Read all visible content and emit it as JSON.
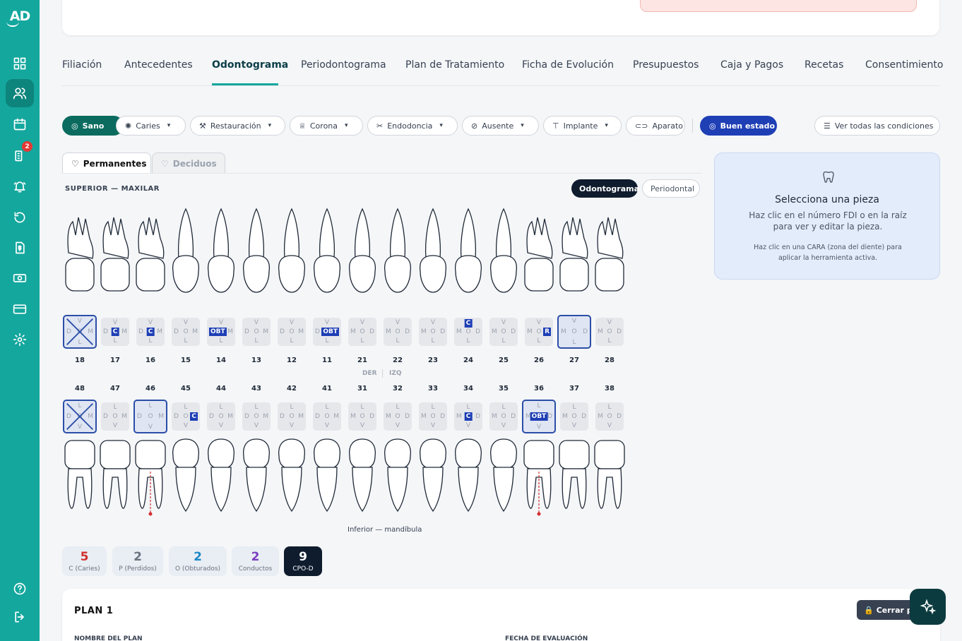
{
  "brand": {
    "logo_text": "AD"
  },
  "sidebar": {
    "badge_count": "2",
    "items": [
      "grid-icon",
      "patients-icon",
      "calendar-icon",
      "clipboard-icon",
      "bell-icon",
      "history-icon",
      "dollar-doc-icon",
      "cash-icon",
      "card-icon",
      "settings-icon",
      "help-icon",
      "logout-icon"
    ]
  },
  "tabs": [
    "Filiación",
    "Antecedentes",
    "Odontograma",
    "Periodontograma",
    "Plan de Tratamiento",
    "Ficha de Evolución",
    "Presupuestos",
    "Caja y Pagos",
    "Recetas",
    "Consentimiento"
  ],
  "toolbar": {
    "sano": "Sano",
    "caries": "Caries",
    "restauracion": "Restauración",
    "corona": "Corona",
    "endodoncia": "Endodoncia",
    "ausente": "Ausente",
    "implante": "Implante",
    "aparato": "Aparato",
    "buen_estado": "Buen estado",
    "ver_todas": "Ver todas las condiciones"
  },
  "dentition_tabs": {
    "permanentes": "Permanentes",
    "deciduos": "Deciduos"
  },
  "view": {
    "upper_label": "SUPERIOR — MAXILAR",
    "odontograma": "Odontograma",
    "periodontal": "Periodontal",
    "der": "DER",
    "izq": "IZQ",
    "lower_label": "Inferior — mandíbula"
  },
  "upper_numbers": [
    "18",
    "17",
    "16",
    "15",
    "14",
    "13",
    "12",
    "11",
    "21",
    "22",
    "23",
    "24",
    "25",
    "26",
    "27",
    "28"
  ],
  "lower_numbers": [
    "48",
    "47",
    "46",
    "45",
    "44",
    "43",
    "42",
    "41",
    "31",
    "32",
    "33",
    "34",
    "35",
    "36",
    "37",
    "38"
  ],
  "face_letters": {
    "top_upper": "V",
    "bottom_upper": "L",
    "top_lower": "L",
    "bottom_lower": "V",
    "left_right": "D",
    "center": "O",
    "mesial": "M"
  },
  "markers": {
    "caries": "C",
    "obturacion": "OBT",
    "restauracion": "R"
  },
  "stats": [
    {
      "value": "5",
      "label": "C (Caries)",
      "color": "#d32f2f"
    },
    {
      "value": "2",
      "label": "P (Perdidos)",
      "color": "#6b7280"
    },
    {
      "value": "2",
      "label": "O (Obturados)",
      "color": "#1e88c8"
    },
    {
      "value": "2",
      "label": "Conductos",
      "color": "#7b3fc4"
    },
    {
      "value": "9",
      "label": "CPO-D",
      "color": "#ffffff"
    }
  ],
  "side_panel": {
    "title": "Selecciona una pieza",
    "desc1": "Haz clic en el número FDI o en la raíz para ver y editar la pieza.",
    "desc2": "Haz clic en una CARA (zona del diente) para aplicar la herramienta activa."
  },
  "plan": {
    "title": "PLAN 1",
    "name_label": "NOMBRE DEL PLAN",
    "date_label": "FECHA DE EVALUACIÓN",
    "close_button": "Cerrar p"
  }
}
